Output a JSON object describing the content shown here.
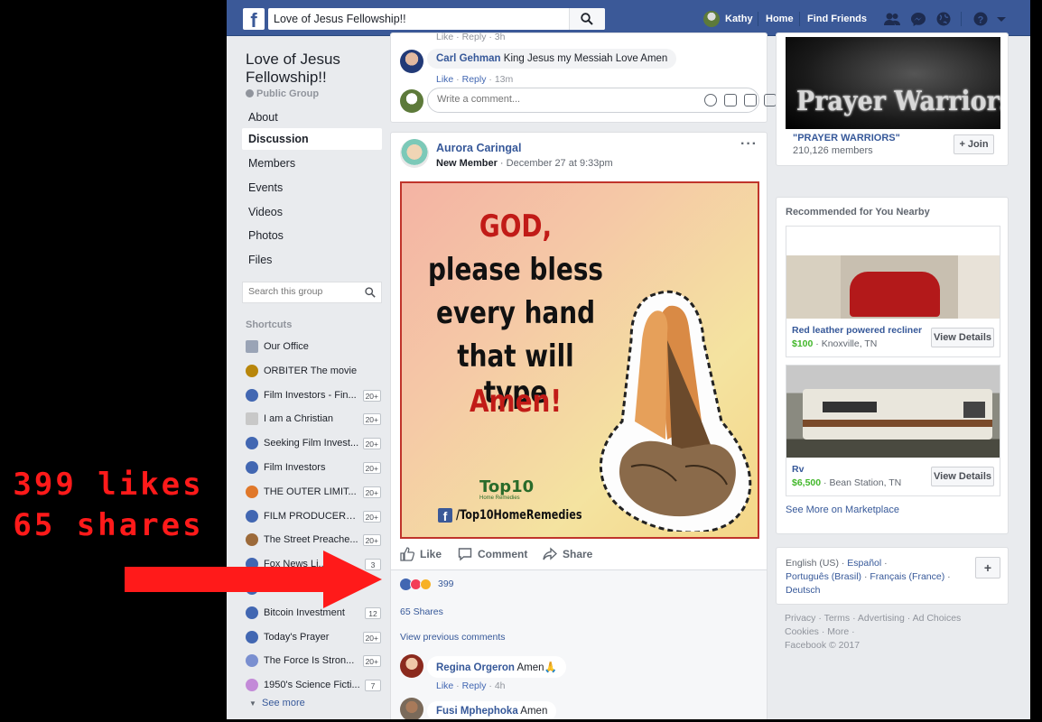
{
  "overlay": {
    "line1": "399 likes",
    "line2": "65 shares",
    "color": "#ff1a1a"
  },
  "topbar": {
    "search_value": "Love of Jesus Fellowship!!",
    "user_name": "Kathy",
    "home_label": "Home",
    "find_friends_label": "Find Friends",
    "brand_color": "#3b5998"
  },
  "group": {
    "title": "Love of Jesus Fellowship!!",
    "type": "Public Group",
    "nav": [
      "About",
      "Discussion",
      "Members",
      "Events",
      "Videos",
      "Photos",
      "Files"
    ],
    "active_nav": "Discussion",
    "search_placeholder": "Search this group",
    "shortcuts_heading": "Shortcuts",
    "shortcuts": [
      {
        "label": "Our Office",
        "badge": "",
        "icon": "office-icon"
      },
      {
        "label": "ORBITER The movie",
        "badge": "",
        "icon": "movie-icon"
      },
      {
        "label": "Film Investors - Fin...",
        "badge": "20+",
        "icon": "group-icon"
      },
      {
        "label": "I am a Christian",
        "badge": "20+",
        "icon": "book-icon"
      },
      {
        "label": "Seeking Film Invest...",
        "badge": "20+",
        "icon": "group-icon"
      },
      {
        "label": "Film Investors",
        "badge": "20+",
        "icon": "group-icon"
      },
      {
        "label": "THE OUTER LIMIT...",
        "badge": "20+",
        "icon": "planet-icon"
      },
      {
        "label": "FILM PRODUCERS,FIN...",
        "badge": "20+",
        "icon": "group-icon"
      },
      {
        "label": "The Street Preache...",
        "badge": "20+",
        "icon": "person-icon"
      },
      {
        "label": "Fox News Li...",
        "badge": "3",
        "icon": "group-icon"
      },
      {
        "label": "",
        "badge": "",
        "icon": "group-icon"
      },
      {
        "label": "Bitcoin Investment",
        "badge": "12",
        "icon": "group-icon"
      },
      {
        "label": "Today's Prayer",
        "badge": "20+",
        "icon": "group-icon"
      },
      {
        "label": "The Force Is Stron...",
        "badge": "20+",
        "icon": "wand-icon"
      },
      {
        "label": "1950's Science Ficti...",
        "badge": "7",
        "icon": "flask-icon"
      }
    ],
    "see_more": "See more"
  },
  "feed": {
    "top_comment_meta": "Like · Reply · 3h",
    "comment1": {
      "name": "Carl Gehman",
      "text": "King Jesus my Messiah Love Amen",
      "like": "Like",
      "reply": "Reply",
      "time": "13m"
    },
    "write_placeholder": "Write a comment...",
    "post": {
      "author": "Aurora Caringal",
      "role": "New Member",
      "date": "December 27 at 9:33pm",
      "image_text": [
        "GOD,",
        "please bless",
        "every hand",
        "that will type",
        "Amen!"
      ],
      "image_brand": "Top10",
      "image_brand_sub": "Home Remedies",
      "image_handle": "/Top10HomeRemedies",
      "like_label": "Like",
      "comment_label": "Comment",
      "share_label": "Share",
      "reactions_count": "399",
      "shares": "65 Shares",
      "view_previous": "View previous comments"
    },
    "comment2": {
      "name": "Regina Orgeron",
      "text": "Amen🙏",
      "like": "Like",
      "reply": "Reply",
      "time": "4h"
    },
    "comment3": {
      "name": "Fusi Mphephoka",
      "text": "Amen"
    }
  },
  "right": {
    "prayer": {
      "banner": "Prayer Warriors",
      "name": "\"PRAYER WARRIORS\"",
      "members": "210,126 members",
      "join": "+ Join"
    },
    "recommended_heading": "Recommended for You Nearby",
    "items": [
      {
        "title": "Red leather powered recliner",
        "price": "$100",
        "location": "Knoxville, TN",
        "button": "View Details"
      },
      {
        "title": "Rv",
        "price": "$6,500",
        "location": "Bean Station, TN",
        "button": "View Details"
      }
    ],
    "see_more_marketplace": "See More on Marketplace",
    "languages": [
      "English (US)",
      "Español",
      "Português (Brasil)",
      "Français (France)",
      "Deutsch"
    ],
    "footer_line1": "Privacy · Terms · Advertising · Ad Choices",
    "footer_line2": "Cookies · More ·",
    "footer_line3": "Facebook © 2017"
  }
}
